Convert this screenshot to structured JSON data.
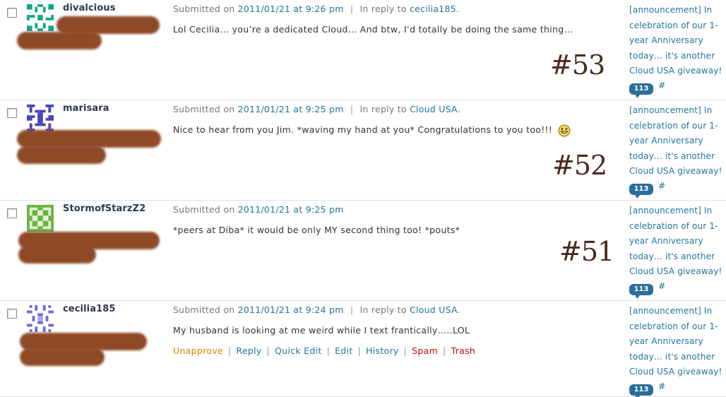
{
  "comments": [
    {
      "author": "divalcious",
      "submitted_prefix": "Submitted on",
      "date": "2011/01/21 at 9:26 pm",
      "separator": "|",
      "in_reply_prefix": "In reply to",
      "reply_to": "cecilia185",
      "reply_suffix": ".",
      "text": "Lol Cecilia… you’re a dedicated Cloud… And btw, I’d totally be doing the same thing…",
      "number_label": "#53",
      "avatar_color": "#14a58a",
      "post_title": "[announcement] In celebration of our 1-year Anniversary today… it's another Cloud USA giveaway!",
      "comment_count": "113",
      "hash": "#"
    },
    {
      "author": "marisara",
      "submitted_prefix": "Submitted on",
      "date": "2011/01/21 at 9:25 pm",
      "separator": "|",
      "in_reply_prefix": "In reply to",
      "reply_to": "Cloud USA",
      "reply_suffix": ".",
      "text": "Nice to hear from you Jim. *waving my hand at you* Congratulations to you too!!!",
      "number_label": "#52",
      "avatar_color": "#4a44b8",
      "post_title": "[announcement] In celebration of our 1-year Anniversary today… it's another Cloud USA giveaway!",
      "comment_count": "113",
      "hash": "#"
    },
    {
      "author": "StormofStarzZ2",
      "submitted_prefix": "Submitted on",
      "date": "2011/01/21 at 9:25 pm",
      "text": "*peers at Diba* it would be only MY second thing too! *pouts*",
      "number_label": "#51",
      "avatar_color": "#6cb341",
      "post_title": "[announcement] In celebration of our 1-year Anniversary today… it's another Cloud USA giveaway!",
      "comment_count": "113",
      "hash": "#"
    },
    {
      "author": "cecilia185",
      "submitted_prefix": "Submitted on",
      "date": "2011/01/21 at 9:24 pm",
      "separator": "|",
      "in_reply_prefix": "In reply to",
      "reply_to": "Cloud USA",
      "reply_suffix": ".",
      "text": "My husband is looking at me weird while I text frantically…..LOL",
      "avatar_color": "#6a6ad0",
      "post_title": "[announcement] In celebration of our 1-year Anniversary today… it's another Cloud USA giveaway!",
      "comment_count": "113",
      "hash": "#",
      "actions": {
        "unapprove": "Unapprove",
        "reply": "Reply",
        "quick_edit": "Quick Edit",
        "edit": "Edit",
        "history": "History",
        "spam": "Spam",
        "trash": "Trash",
        "bar": "|"
      }
    }
  ],
  "icons": {
    "checkbox": "checkbox-icon",
    "avatar": "identicon-avatar-icon",
    "smiley": "smiley-face-icon",
    "comment_bubble": "comment-count-bubble-icon"
  }
}
